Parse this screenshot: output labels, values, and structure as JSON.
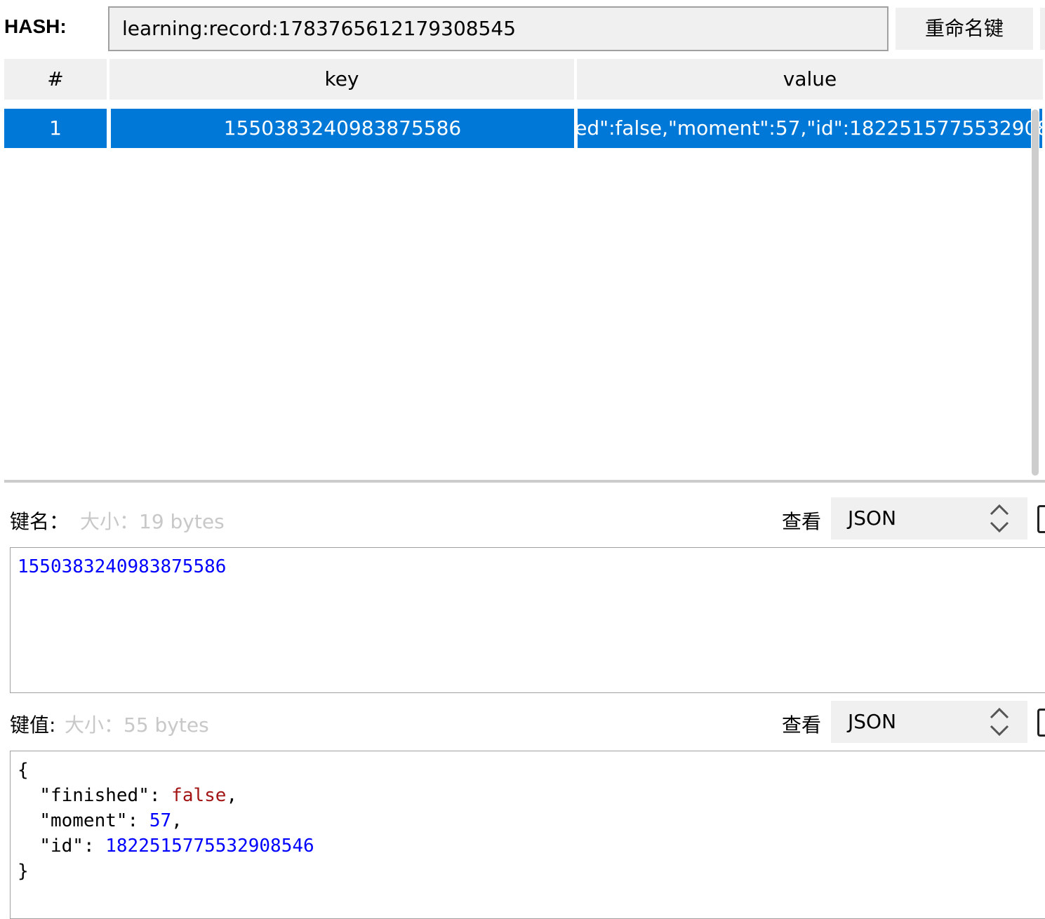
{
  "header": {
    "type_label": "HASH:",
    "key_name": "learning:record:1783765612179308545",
    "rename_button": "重命名键"
  },
  "table": {
    "columns": [
      "#",
      "key",
      "value"
    ],
    "rows": [
      {
        "index": "1",
        "key": "1550383240983875586",
        "value": "{\"finished\":false,\"moment\":57,\"id\":1822515775532908546}"
      }
    ]
  },
  "key_section": {
    "label": "键名：",
    "size_text": "大小：19 bytes",
    "view_label": "查看",
    "format": "JSON",
    "content": "1550383240983875586"
  },
  "value_section": {
    "label": "键值:",
    "size_text": "大小：55 bytes",
    "view_label": "查看",
    "format": "JSON",
    "json": {
      "open": "{",
      "close": "}",
      "fields": [
        {
          "key": "\"finished\"",
          "value": "false",
          "type": "bool",
          "comma": ","
        },
        {
          "key": "\"moment\"",
          "value": "57",
          "type": "number",
          "comma": ","
        },
        {
          "key": "\"id\"",
          "value": "1822515775532908546",
          "type": "number",
          "comma": ""
        }
      ]
    }
  },
  "colors": {
    "selection": "#0078d7",
    "json_number": "#0000ff",
    "json_bool": "#a31515"
  },
  "icons": {
    "select_arrows": "chevron-up-down-icon",
    "copy": "copy-icon"
  }
}
